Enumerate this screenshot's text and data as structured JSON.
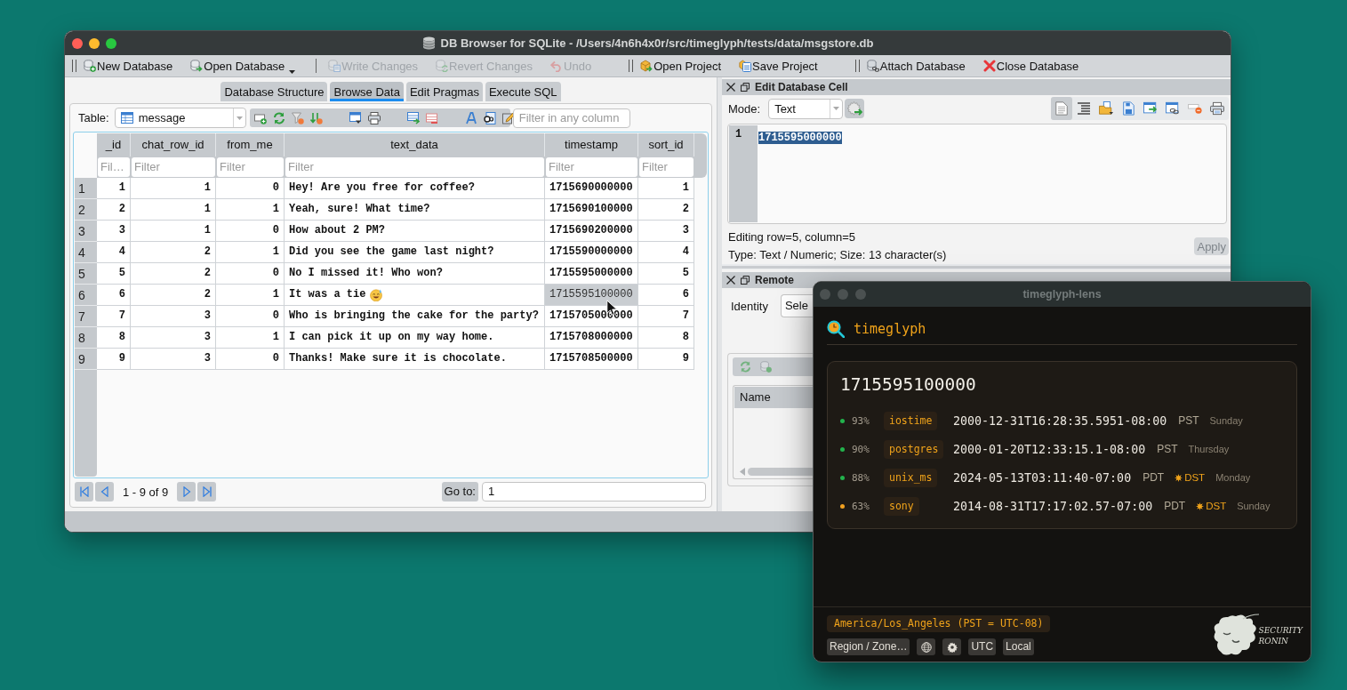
{
  "window": {
    "title": "DB Browser for SQLite - /Users/4n6h4x0r/src/timeglyph/tests/data/msgstore.db"
  },
  "toolbar": {
    "groups": [
      {
        "items": [
          {
            "kind": "new",
            "label": "New Database",
            "disabled": false,
            "dropdown": false
          },
          {
            "kind": "open",
            "label": "Open Database",
            "disabled": false,
            "dropdown": true
          },
          {
            "kind": "separator"
          },
          {
            "kind": "write",
            "label": "Write Changes",
            "disabled": true,
            "dropdown": false
          },
          {
            "kind": "revert",
            "label": "Revert Changes",
            "disabled": true,
            "dropdown": false
          },
          {
            "kind": "undo",
            "label": "Undo",
            "disabled": true,
            "dropdown": false
          }
        ]
      },
      {
        "items": [
          {
            "kind": "open-project",
            "label": "Open Project",
            "disabled": false,
            "dropdown": false
          },
          {
            "kind": "save-project",
            "label": "Save Project",
            "disabled": false,
            "dropdown": false
          }
        ]
      },
      {
        "items": [
          {
            "kind": "attach",
            "label": "Attach Database",
            "disabled": false,
            "dropdown": false
          },
          {
            "kind": "close",
            "label": "Close Database",
            "disabled": false,
            "dropdown": false
          }
        ]
      }
    ]
  },
  "tabs": [
    {
      "label": "Database Structure",
      "selected": false
    },
    {
      "label": "Browse Data",
      "selected": true
    },
    {
      "label": "Edit Pragmas",
      "selected": false
    },
    {
      "label": "Execute SQL",
      "selected": false
    }
  ],
  "browse": {
    "table_label": "Table:",
    "table": "message",
    "filter_placeholder": "Filter in any column",
    "columns": [
      {
        "name": "_id",
        "kind": "number",
        "filter_placeholder": "Fil…"
      },
      {
        "name": "chat_row_id",
        "kind": "number",
        "filter_placeholder": "Filter"
      },
      {
        "name": "from_me",
        "kind": "number",
        "filter_placeholder": "Filter"
      },
      {
        "name": "text_data",
        "kind": "text",
        "filter_placeholder": "Filter"
      },
      {
        "name": "timestamp",
        "kind": "text",
        "filter_placeholder": "Filter"
      },
      {
        "name": "sort_id",
        "kind": "number",
        "filter_placeholder": "Filter"
      }
    ],
    "rows": [
      {
        "number": "1",
        "emoji": false,
        "cells": [
          {
            "text": "1",
            "selected": false
          },
          {
            "text": "1",
            "selected": false
          },
          {
            "text": "0",
            "selected": false
          },
          {
            "text": "Hey! Are you free for coffee?",
            "selected": false
          },
          {
            "text": "1715690000000",
            "selected": false
          },
          {
            "text": "1",
            "selected": false
          }
        ]
      },
      {
        "number": "2",
        "emoji": false,
        "cells": [
          {
            "text": "2",
            "selected": false
          },
          {
            "text": "1",
            "selected": false
          },
          {
            "text": "1",
            "selected": false
          },
          {
            "text": "Yeah, sure! What time?",
            "selected": false
          },
          {
            "text": "1715690100000",
            "selected": false
          },
          {
            "text": "2",
            "selected": false
          }
        ]
      },
      {
        "number": "3",
        "emoji": false,
        "cells": [
          {
            "text": "3",
            "selected": false
          },
          {
            "text": "1",
            "selected": false
          },
          {
            "text": "0",
            "selected": false
          },
          {
            "text": "How about 2 PM?",
            "selected": false
          },
          {
            "text": "1715690200000",
            "selected": false
          },
          {
            "text": "3",
            "selected": false
          }
        ]
      },
      {
        "number": "4",
        "emoji": false,
        "cells": [
          {
            "text": "4",
            "selected": false
          },
          {
            "text": "2",
            "selected": false
          },
          {
            "text": "1",
            "selected": false
          },
          {
            "text": "Did you see the game last night?",
            "selected": false
          },
          {
            "text": "1715590000000",
            "selected": false
          },
          {
            "text": "4",
            "selected": false
          }
        ]
      },
      {
        "number": "5",
        "emoji": false,
        "cells": [
          {
            "text": "5",
            "selected": false
          },
          {
            "text": "2",
            "selected": false
          },
          {
            "text": "0",
            "selected": false
          },
          {
            "text": "No I missed it! Who won?",
            "selected": false
          },
          {
            "text": "1715595000000",
            "selected": false
          },
          {
            "text": "5",
            "selected": false
          }
        ]
      },
      {
        "number": "6",
        "emoji": true,
        "cells": [
          {
            "text": "6",
            "selected": false
          },
          {
            "text": "2",
            "selected": false
          },
          {
            "text": "1",
            "selected": false
          },
          {
            "text": "It was a tie",
            "selected": false
          },
          {
            "text": "1715595100000",
            "selected": true
          },
          {
            "text": "6",
            "selected": false
          }
        ]
      },
      {
        "number": "7",
        "emoji": false,
        "cells": [
          {
            "text": "7",
            "selected": false
          },
          {
            "text": "3",
            "selected": false
          },
          {
            "text": "0",
            "selected": false
          },
          {
            "text": "Who is bringing the cake for the party?",
            "selected": false
          },
          {
            "text": "1715705000000",
            "selected": false
          },
          {
            "text": "7",
            "selected": false
          }
        ]
      },
      {
        "number": "8",
        "emoji": false,
        "cells": [
          {
            "text": "8",
            "selected": false
          },
          {
            "text": "3",
            "selected": false
          },
          {
            "text": "1",
            "selected": false
          },
          {
            "text": "I can pick it up on my way home.",
            "selected": false
          },
          {
            "text": "1715708000000",
            "selected": false
          },
          {
            "text": "8",
            "selected": false
          }
        ]
      },
      {
        "number": "9",
        "emoji": false,
        "cells": [
          {
            "text": "9",
            "selected": false
          },
          {
            "text": "3",
            "selected": false
          },
          {
            "text": "0",
            "selected": false
          },
          {
            "text": "Thanks! Make sure it is chocolate.",
            "selected": false
          },
          {
            "text": "1715708500000",
            "selected": false
          },
          {
            "text": "9",
            "selected": false
          }
        ]
      }
    ],
    "pager": {
      "range": "1 - 9 of 9",
      "goto_label": "Go to:",
      "goto_value": "1"
    }
  },
  "edit_cell": {
    "title": "Edit Database Cell",
    "mode_label": "Mode:",
    "mode": "Text",
    "tools": [
      {
        "kind": "text",
        "selected": true
      },
      {
        "kind": "wrap",
        "selected": false
      },
      {
        "kind": "import",
        "selected": false
      },
      {
        "kind": "export",
        "selected": false
      },
      {
        "kind": "apply",
        "selected": false
      },
      {
        "kind": "link",
        "selected": false
      },
      {
        "kind": "null",
        "selected": false
      },
      {
        "kind": "print",
        "selected": false
      }
    ],
    "line_number": "1",
    "value": "1715595000000",
    "status": "Editing row=5, column=5",
    "type_info": "Type: Text / Numeric; Size: 13 character(s)",
    "apply": {
      "label": "Apply",
      "disabled": true
    }
  },
  "remote": {
    "title": "Remote",
    "identity_label": "Identity",
    "identity_value": "Sele",
    "tree_header": "Name"
  },
  "lens": {
    "title": "timeglyph-lens",
    "app_name": "timeglyph",
    "input": "1715595100000",
    "results": [
      {
        "color": "#22b24c",
        "confidence": "93%",
        "format": "iostime",
        "timestamp": "2000-12-31T16:28:35.5951-08:00",
        "zone": "PST",
        "weekday": "Sunday"
      },
      {
        "color": "#22b24c",
        "confidence": "90%",
        "format": "postgres",
        "timestamp": "2000-01-20T12:33:15.1-08:00",
        "zone": "PST",
        "weekday": "Thursday"
      },
      {
        "color": "#22b24c",
        "confidence": "88%",
        "format": "unix_ms",
        "timestamp": "2024-05-13T03:11:40-07:00",
        "zone": "PDT",
        "dst": "DST",
        "weekday": "Monday"
      },
      {
        "color": "#f0a020",
        "confidence": "63%",
        "format": "sony",
        "timestamp": "2014-08-31T17:17:02.57-07:00",
        "zone": "PDT",
        "dst": "DST",
        "weekday": "Sunday"
      }
    ],
    "timezone": "America/Los_Angeles (PST = UTC-08)",
    "buttons": [
      {
        "kind": "text",
        "label": "Region / Zone…"
      },
      {
        "kind": "globe"
      },
      {
        "kind": "gear"
      },
      {
        "kind": "text",
        "label": "UTC"
      },
      {
        "kind": "text",
        "label": "Local"
      }
    ],
    "logo": [
      "SECURITY",
      "RONIN"
    ]
  }
}
